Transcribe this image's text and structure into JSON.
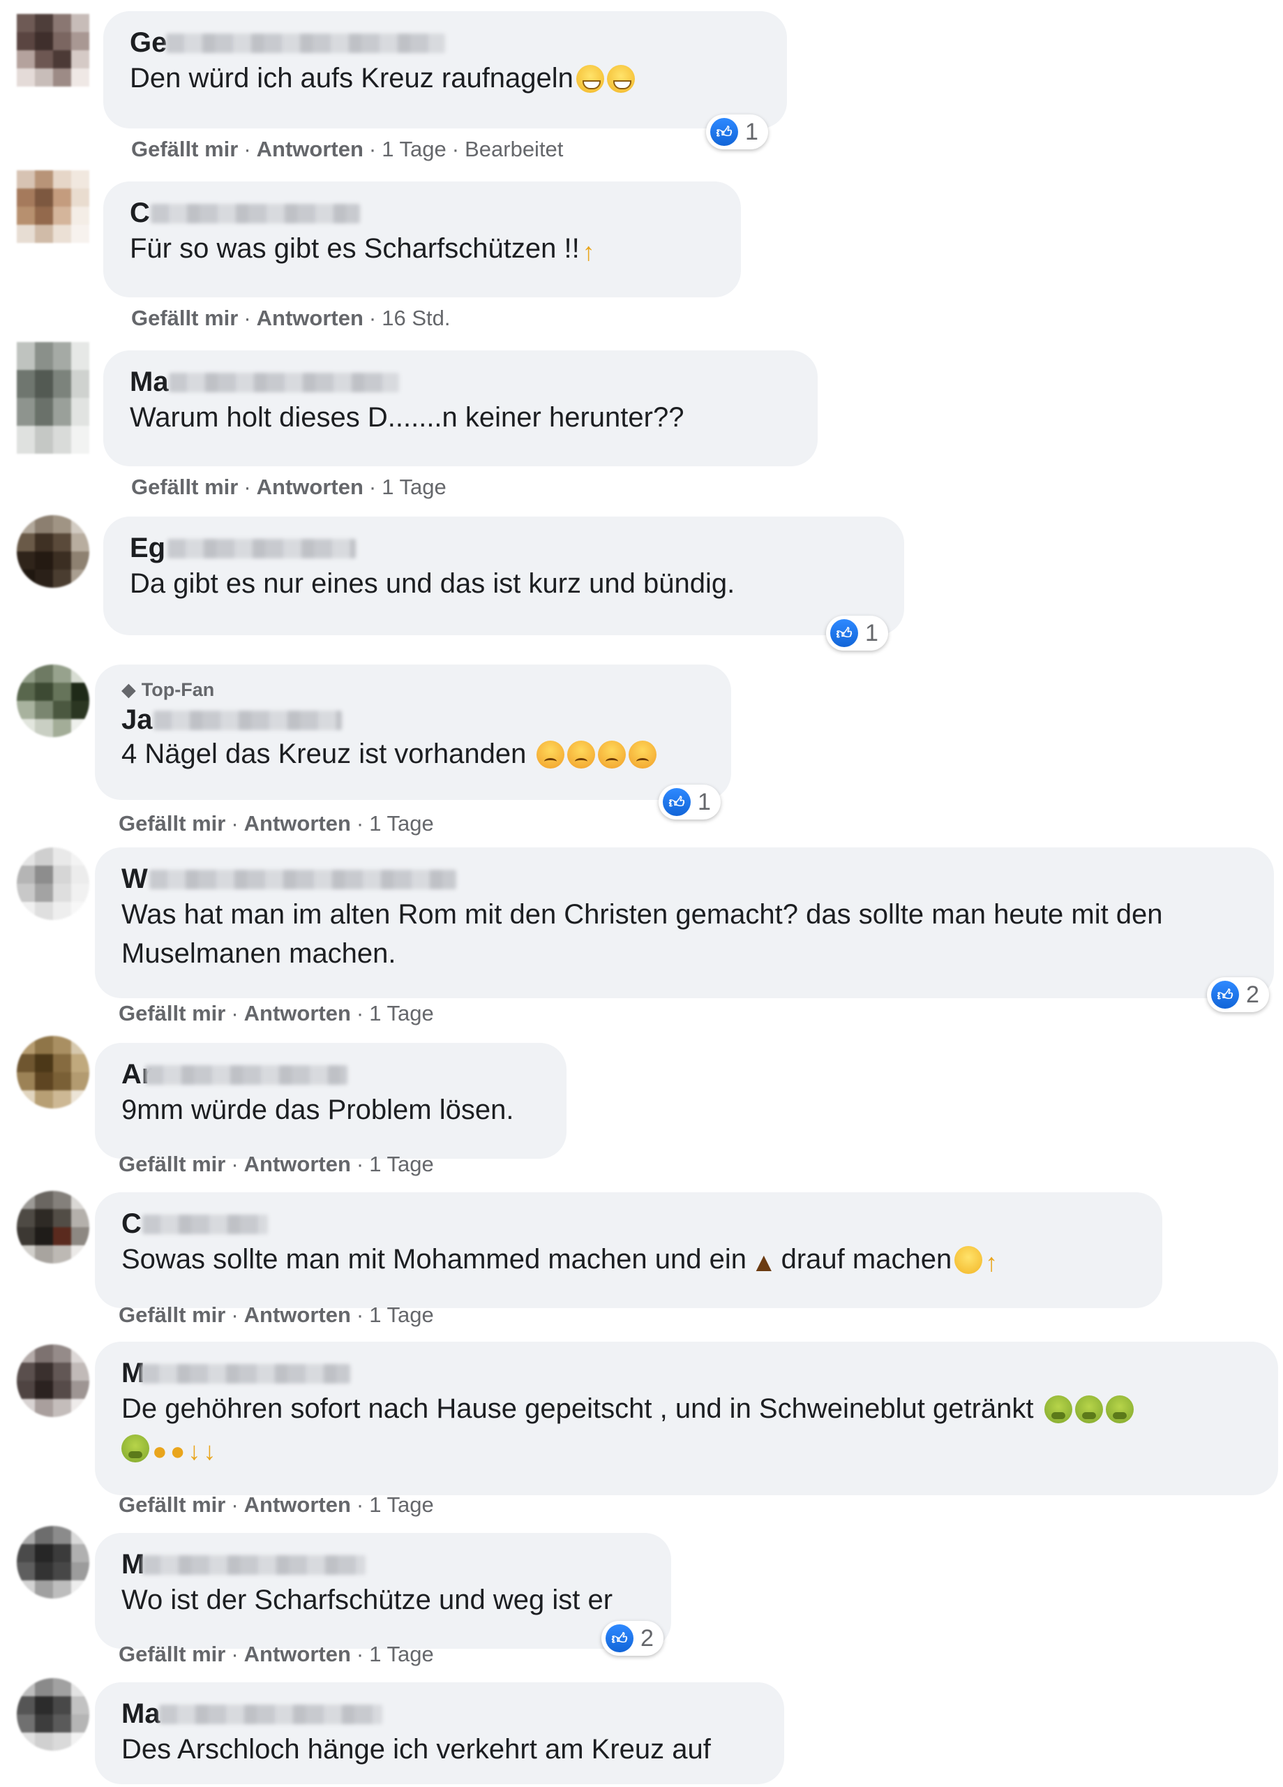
{
  "actions": {
    "like": "Gefällt mir",
    "reply": "Antworten",
    "edited": "Bearbeitet"
  },
  "comments": [
    {
      "initial": "Ge",
      "text": "Den würd ich aufs Kreuz raufnageln",
      "time": "1 Tage",
      "reactions": "1"
    },
    {
      "initial": "C",
      "text": "Für so was gibt es Scharfschützen !!",
      "time": "16 Std."
    },
    {
      "initial": "Ma",
      "text": "Warum holt dieses D.......n keiner herunter??",
      "time": "1 Tage"
    },
    {
      "initial": "Eg",
      "text": "Da gibt es nur eines und das ist kurz und bündig.",
      "reactions": "1"
    },
    {
      "badge": "Top-Fan",
      "initial": "Ja",
      "text": "4 Nägel das Kreuz ist vorhanden",
      "time": "1 Tage",
      "reactions": "1"
    },
    {
      "initial": "W",
      "text": "Was hat man im alten Rom mit den Christen gemacht? das sollte man heute mit den Muselmanen machen.",
      "time": "1 Tage",
      "reactions": "2"
    },
    {
      "initial": "Ar",
      "text": "9mm würde das Problem lösen.",
      "time": "1 Tage"
    },
    {
      "initial": "C",
      "text_a": "Sowas sollte man mit Mohammed machen und ein",
      "text_b": "drauf machen",
      "time": "1 Tage"
    },
    {
      "initial": "M",
      "text": "De gehöhren sofort nach Hause gepeitscht , und in Schweineblut getränkt",
      "time": "1 Tage"
    },
    {
      "initial": "M",
      "text": "Wo ist der Scharfschütze und weg ist er",
      "time": "1 Tage",
      "reactions": "2"
    },
    {
      "initial": "Ma",
      "text": "Des Arschloch hänge ich verkehrt am Kreuz auf"
    }
  ],
  "colors": {
    "bubble": "#f0f2f5",
    "meta": "#65676b",
    "like_blue": "#1877f2"
  }
}
